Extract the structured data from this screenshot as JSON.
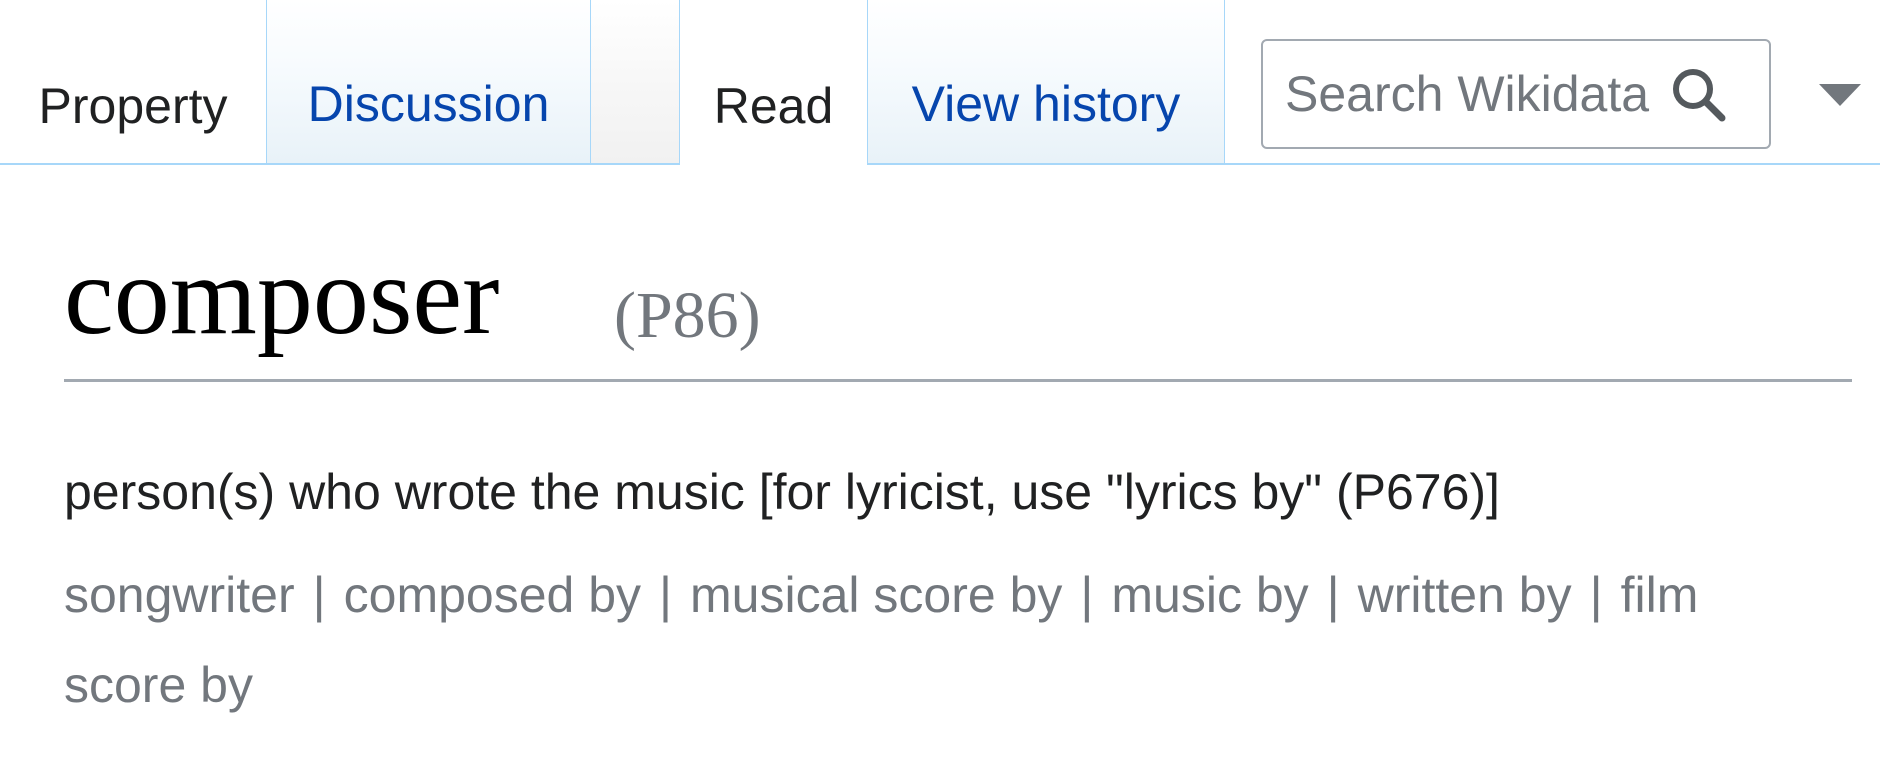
{
  "tabs": {
    "property": "Property",
    "discussion": "Discussion",
    "read": "Read",
    "view_history": "View history"
  },
  "search": {
    "placeholder": "Search Wikidata",
    "icon": "search-icon"
  },
  "more_menu": {
    "icon": "chevron-down-icon"
  },
  "heading": {
    "label": "composer",
    "id": "(P86)"
  },
  "description": "person(s) who wrote the music [for lyricist, use \"lyrics by\" (P676)]",
  "aliases": {
    "separator": "|",
    "items": [
      "songwriter",
      "composed by",
      "musical score by",
      "music by",
      "written by",
      "film score by"
    ]
  },
  "colors": {
    "link": "#0645ad",
    "tab_border": "#a7d7f9",
    "muted": "#72777d",
    "text": "#202122"
  }
}
